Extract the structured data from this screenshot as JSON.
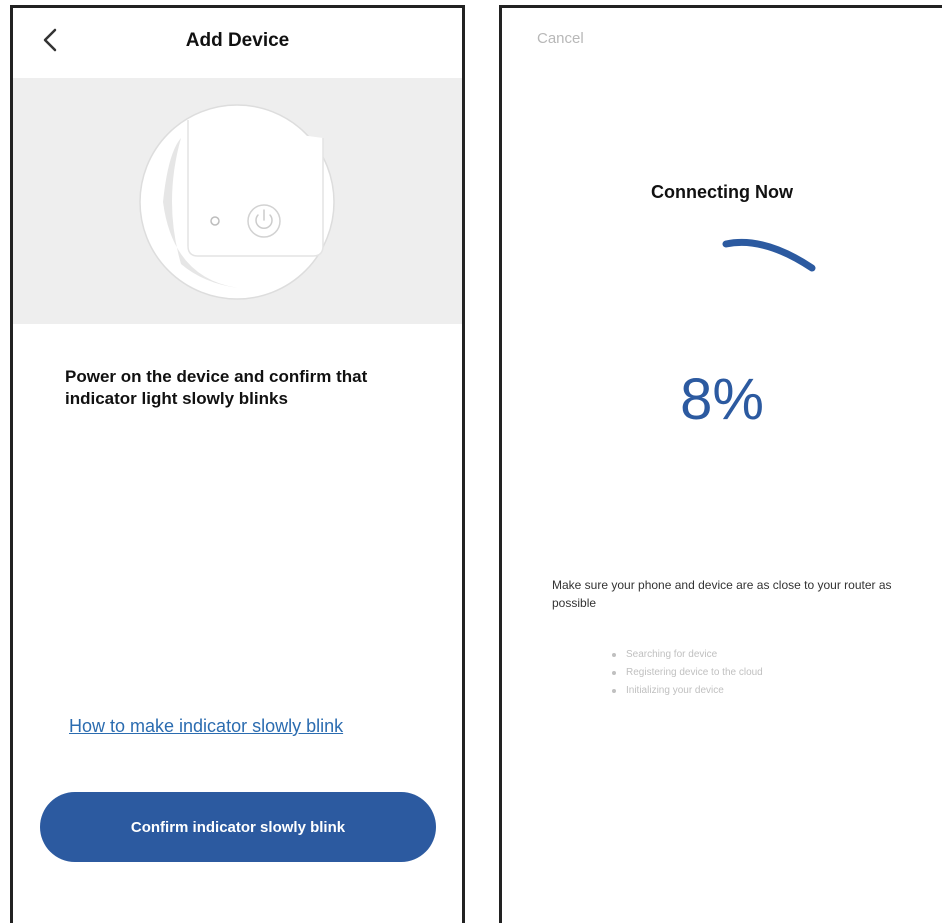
{
  "left_screen": {
    "header": {
      "title": "Add Device"
    },
    "instruction": "Power on the device and confirm that indicator light slowly blinks",
    "help_link": "How to make indicator slowly blink",
    "confirm_button": "Confirm indicator slowly blink"
  },
  "right_screen": {
    "cancel_label": "Cancel",
    "title": "Connecting Now",
    "progress": {
      "percent": 8,
      "label": "8%"
    },
    "tip": "Make sure your phone and device are as close to your router as possible",
    "steps": [
      "Searching for device",
      "Registering device to the cloud",
      "Initializing your device"
    ]
  },
  "colors": {
    "primary_blue": "#2c5aa0",
    "link_blue": "#2b6cb0",
    "illustration_bg": "#eeeeee",
    "muted_text": "#c0c0c0"
  },
  "icons": {
    "back": "chevron-left-icon",
    "power": "power-icon",
    "spinner": "loading-spinner-icon"
  }
}
